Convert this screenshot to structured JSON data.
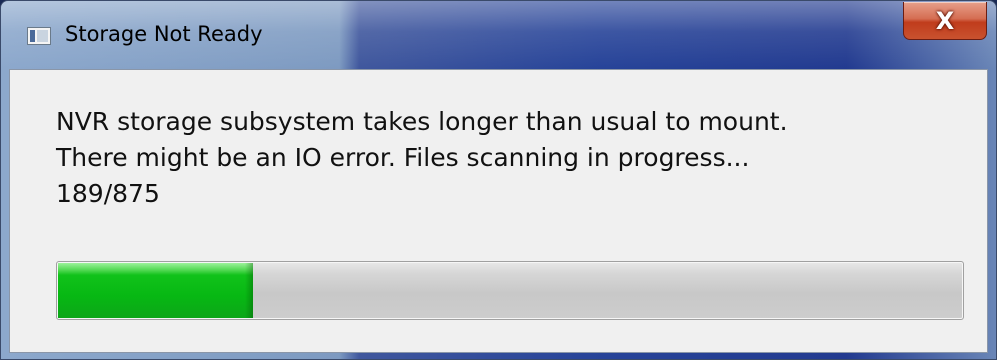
{
  "window": {
    "title": "Storage Not Ready",
    "close_label": "X"
  },
  "message": {
    "lines": [
      "NVR storage subsystem takes longer than usual to mount.",
      "There might be an IO error. Files scanning in progress...",
      "189/875"
    ]
  },
  "progress": {
    "current": 189,
    "total": 875,
    "fraction": 0.216
  },
  "colors": {
    "progress_fill": "#11c21a",
    "close_button": "#c03c1c",
    "client_background": "#f0f0f0"
  },
  "icons": {
    "app": "window-app-icon",
    "close": "close-icon"
  }
}
